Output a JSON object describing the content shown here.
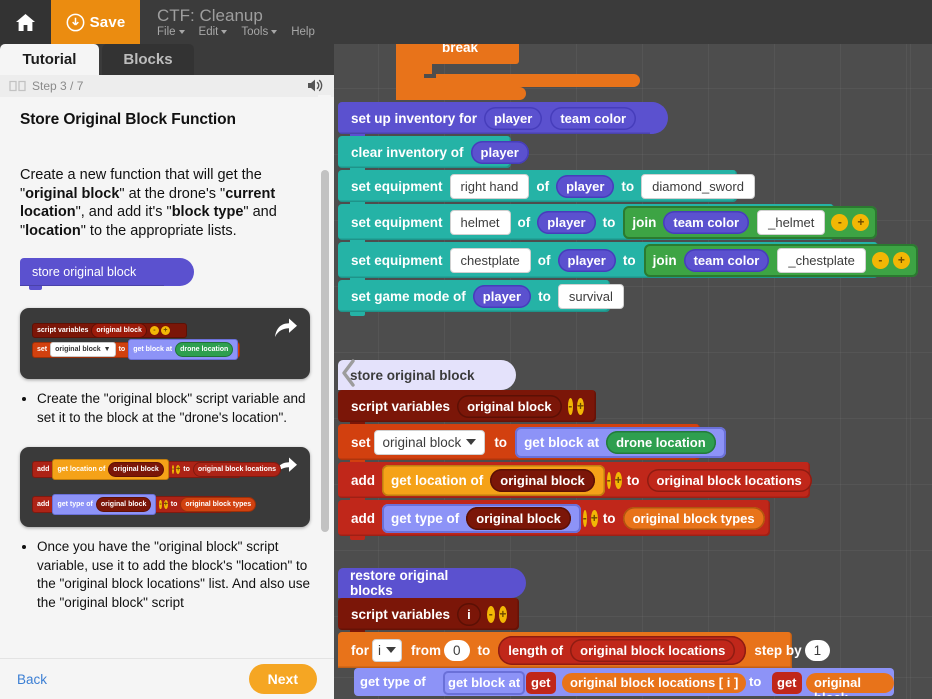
{
  "menubar": {
    "home_icon": "home-icon",
    "save_label": "Save",
    "save_icon": "download-circle-icon",
    "project_title": "CTF: Cleanup",
    "menus": [
      {
        "label": "File",
        "has_caret": true
      },
      {
        "label": "Edit",
        "has_caret": true
      },
      {
        "label": "Tools",
        "has_caret": true
      },
      {
        "label": "Help",
        "has_caret": false
      }
    ]
  },
  "tabs": [
    {
      "label": "Tutorial",
      "active": true
    },
    {
      "label": "Blocks",
      "active": false
    }
  ],
  "tutorial": {
    "book_icon": "book-icon",
    "step_label": "Step 3 / 7",
    "speaker_icon": "speaker-icon",
    "title": "Store Original Block Function",
    "paragraph": {
      "p1": "Create a new function that will get the ",
      "b1": "original block",
      "p2": " at the drone's ",
      "b2": "current location",
      "p3": ", and add it's ",
      "b3": "block type",
      "p4": " and ",
      "b4": "location",
      "p5": " to the appropriate lists."
    },
    "hat_block_label": "store original block",
    "cards": [
      {
        "share_icon": "share-arrow-icon",
        "rows": [
          [
            "script variables",
            "original block",
            "-",
            "+"
          ],
          [
            "set",
            "original block",
            "to",
            "get block at",
            "drone location"
          ]
        ],
        "bullet": "Create the \"original block\" script variable and set it to the block at the \"drone's location\"."
      },
      {
        "share_icon": "share-arrow-icon",
        "rows": [
          [
            "add",
            "get location of",
            "original block",
            "-",
            "+",
            "to",
            "original block locations"
          ],
          [
            "add",
            "get type of",
            "original block",
            "-",
            "+",
            "to",
            "original block types"
          ]
        ],
        "bullet": "Once you have the \"original block\" script variable, use it to add the block's \"location\" to the \"original block locations\" list.",
        "bullet_clipped": "And also use the \"original block\" script"
      }
    ],
    "footer": {
      "back_label": "Back",
      "next_label": "Next"
    }
  },
  "workspace": {
    "collapse_icon": "chevron-left-icon",
    "break_block": "break",
    "stacks": [
      {
        "name": "inventory-setup",
        "rows": [
          {
            "kind": "purple-hat-row",
            "parts": [
              {
                "t": "label",
                "v": "set up inventory for"
              },
              {
                "t": "rep-purple",
                "v": "player"
              },
              {
                "t": "rep-purple",
                "v": "team color"
              }
            ]
          },
          {
            "kind": "teal",
            "parts": [
              {
                "t": "label",
                "v": "clear inventory of"
              },
              {
                "t": "rep-purple",
                "v": "player"
              }
            ]
          },
          {
            "kind": "teal",
            "parts": [
              {
                "t": "label",
                "v": "set equipment"
              },
              {
                "t": "field-white",
                "v": "right hand"
              },
              {
                "t": "label",
                "v": "of"
              },
              {
                "t": "rep-purple",
                "v": "player"
              },
              {
                "t": "label",
                "v": "to"
              },
              {
                "t": "field-white",
                "v": "diamond_sword"
              }
            ]
          },
          {
            "kind": "teal",
            "parts": [
              {
                "t": "label",
                "v": "set equipment"
              },
              {
                "t": "field-white",
                "v": "helmet"
              },
              {
                "t": "label",
                "v": "of"
              },
              {
                "t": "rep-purple",
                "v": "player"
              },
              {
                "t": "label",
                "v": "to"
              },
              {
                "t": "join",
                "v": "join",
                "inner": "team color",
                "text": "_helmet",
                "minus": "-",
                "plus": "+"
              }
            ]
          },
          {
            "kind": "teal",
            "parts": [
              {
                "t": "label",
                "v": "set equipment"
              },
              {
                "t": "field-white",
                "v": "chestplate"
              },
              {
                "t": "label",
                "v": "of"
              },
              {
                "t": "rep-purple",
                "v": "player"
              },
              {
                "t": "label",
                "v": "to"
              },
              {
                "t": "join",
                "v": "join",
                "inner": "team color",
                "text": "_chestplate",
                "minus": "-",
                "plus": "+"
              }
            ]
          },
          {
            "kind": "teal",
            "parts": [
              {
                "t": "label",
                "v": "set game mode of"
              },
              {
                "t": "rep-purple",
                "v": "player"
              },
              {
                "t": "label",
                "v": "to"
              },
              {
                "t": "field-white",
                "v": "survival"
              }
            ]
          }
        ]
      },
      {
        "name": "store-original-block",
        "hat": "store original block",
        "rows": [
          {
            "kind": "darkred",
            "parts": [
              {
                "t": "label",
                "v": "script variables"
              },
              {
                "t": "rep-darkred",
                "v": "original block"
              },
              {
                "t": "pm",
                "v": "-"
              },
              {
                "t": "pm",
                "v": "+"
              }
            ]
          },
          {
            "kind": "orangedeep",
            "parts": [
              {
                "t": "label",
                "v": "set"
              },
              {
                "t": "dropdown-white",
                "v": "original block"
              },
              {
                "t": "label",
                "v": "to"
              },
              {
                "t": "rep-blue",
                "v": "get block at"
              },
              {
                "t": "rep-green",
                "v": "drone location"
              }
            ]
          },
          {
            "kind": "red",
            "parts": [
              {
                "t": "label",
                "v": "add"
              },
              {
                "t": "rep-orangel",
                "v": "get location of"
              },
              {
                "t": "rep-darkred",
                "v": "original block"
              },
              {
                "t": "pm",
                "v": "-"
              },
              {
                "t": "pm",
                "v": "+"
              },
              {
                "t": "label",
                "v": "to"
              },
              {
                "t": "rep-red",
                "v": "original block locations"
              }
            ]
          },
          {
            "kind": "red",
            "parts": [
              {
                "t": "label",
                "v": "add"
              },
              {
                "t": "rep-blue",
                "v": "get type of"
              },
              {
                "t": "rep-darkred",
                "v": "original block"
              },
              {
                "t": "pm",
                "v": "-"
              },
              {
                "t": "pm",
                "v": "+"
              },
              {
                "t": "label",
                "v": "to"
              },
              {
                "t": "rep-orange",
                "v": "original block types"
              }
            ]
          }
        ]
      },
      {
        "name": "restore-original-blocks",
        "hat": "restore original blocks",
        "rows": [
          {
            "kind": "darkred",
            "parts": [
              {
                "t": "label",
                "v": "script variables"
              },
              {
                "t": "rep-darkred",
                "v": "i"
              },
              {
                "t": "pm",
                "v": "-"
              },
              {
                "t": "pm",
                "v": "+"
              }
            ]
          },
          {
            "kind": "orange",
            "parts": [
              {
                "t": "label",
                "v": "for"
              },
              {
                "t": "dropdown-white",
                "v": "i"
              },
              {
                "t": "label",
                "v": "from"
              },
              {
                "t": "num-white",
                "v": "0"
              },
              {
                "t": "label",
                "v": "to"
              },
              {
                "t": "rep-red",
                "v": "length of"
              },
              {
                "t": "rep-red2",
                "v": "original block locations"
              },
              {
                "t": "label",
                "v": "step by"
              },
              {
                "t": "num-white",
                "v": "1"
              }
            ]
          },
          {
            "kind": "clipped",
            "parts": [
              {
                "t": "label",
                "v": "get type of"
              },
              {
                "t": "label",
                "v": "get block at"
              },
              {
                "t": "label",
                "v": "get"
              },
              {
                "t": "label",
                "v": "original block locations [ i ]"
              },
              {
                "t": "label",
                "v": "to"
              },
              {
                "t": "label",
                "v": "get"
              },
              {
                "t": "label",
                "v": "original block"
              }
            ]
          }
        ]
      }
    ]
  },
  "colors": {
    "accent_orange": "#eb8c10",
    "next_button": "#f5a623",
    "teal_block": "#25b3a6",
    "purple_block": "#5b51cf",
    "dark_red_block": "#7b1608",
    "red_block": "#c0271a",
    "orange_block": "#e8731a",
    "green_block": "#2e9f4f",
    "workspace_bg": "#4d4d4d",
    "menubar_bg": "#3b3b3b",
    "panel_bg": "#f5f5f5"
  }
}
